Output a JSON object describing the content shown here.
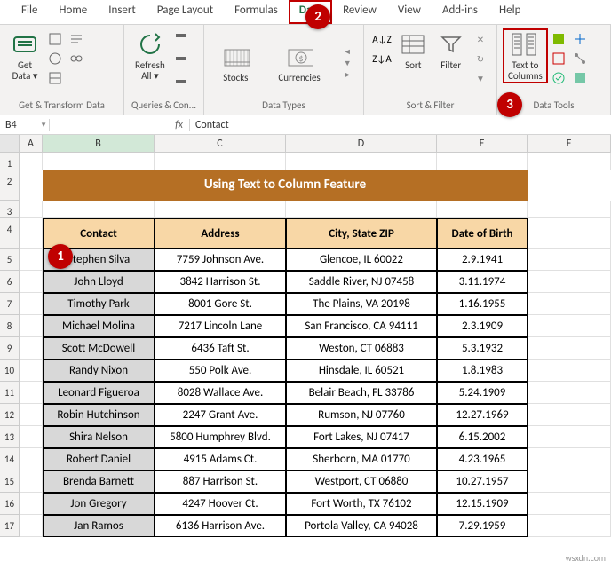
{
  "tabs": [
    "File",
    "Home",
    "Insert",
    "Page Layout",
    "Formulas",
    "Data",
    "Review",
    "View",
    "Add-ins",
    "Help"
  ],
  "active_tab": "Data",
  "ribbon": {
    "get_data": {
      "label": "Get\nData ▾",
      "group": "Get & Transform Data"
    },
    "refresh": {
      "label": "Refresh\nAll ▾",
      "group": "Queries & Con..."
    },
    "stocks": {
      "label": "Stocks"
    },
    "currencies": {
      "label": "Currencies"
    },
    "data_types_group": "Data Types",
    "sort": {
      "label": "Sort"
    },
    "filter": {
      "label": "Filter"
    },
    "sort_filter_group": "Sort & Filter",
    "text_to_columns": {
      "label": "Text to\nColumns"
    },
    "data_tools_group": "Data Tools"
  },
  "name_box": "B4",
  "formula": "Contact",
  "columns": [
    "A",
    "B",
    "C",
    "D",
    "E",
    "F"
  ],
  "title": "Using Text to Column Feature",
  "headers": {
    "contact": "Contact",
    "address": "Address",
    "city": "City, State ZIP",
    "dob": "Date of Birth"
  },
  "rows": [
    {
      "n": "5",
      "contact": "Stephen Silva",
      "address": "7759 Johnson Ave.",
      "city": "Glencoe, IL   60022",
      "dob": "2.9.1941"
    },
    {
      "n": "6",
      "contact": "John Lloyd",
      "address": "3842 Harrison St.",
      "city": "Saddle River, NJ 07458",
      "dob": "3.11.1974"
    },
    {
      "n": "7",
      "contact": "Timothy Park",
      "address": "8001 Gore St.",
      "city": "The Plains, VA   20198",
      "dob": "1.16.1955"
    },
    {
      "n": "8",
      "contact": "Michael Molina",
      "address": "7217 Lincoln Lane",
      "city": "San Francisco, CA   94111",
      "dob": "2.3.1909"
    },
    {
      "n": "9",
      "contact": "Scott McDowell",
      "address": "6436 Taft St.",
      "city": "Weston, CT   06883",
      "dob": "5.3.1932"
    },
    {
      "n": "10",
      "contact": "Randy Nixon",
      "address": "550 Polk Ave.",
      "city": "Hinsdale, IL   60521",
      "dob": "1.8.1983"
    },
    {
      "n": "11",
      "contact": "Leonard Figueroa",
      "address": "8028 Wallace Ave.",
      "city": "Belair Beach, FL   33786",
      "dob": "5.24.1909"
    },
    {
      "n": "12",
      "contact": "Robin Hutchinson",
      "address": "2247 Grant Ave.",
      "city": "Rumson, NJ   07760",
      "dob": "12.27.1969"
    },
    {
      "n": "13",
      "contact": "Shira Nelson",
      "address": "5800 Humphrey Blvd.",
      "city": "Fort Lakes, NJ   07417",
      "dob": "6.15.2002"
    },
    {
      "n": "14",
      "contact": "Robert Daniel",
      "address": "4915 Adams Ct.",
      "city": "Sherborn, MA   01770",
      "dob": "4.23.1965"
    },
    {
      "n": "15",
      "contact": "Brenda Barnett",
      "address": "887 Harrison St.",
      "city": "Westport, CT   06880",
      "dob": "10.27.1957"
    },
    {
      "n": "16",
      "contact": "Jon Gregory",
      "address": "4247 Hoover Ct.",
      "city": "Fort Worth, TX   76102",
      "dob": "12.15.1909"
    },
    {
      "n": "17",
      "contact": "Jan Ramos",
      "address": "6136 Harrison Ave.",
      "city": "Portola Valley, CA   94028",
      "dob": "7.29.1959"
    }
  ],
  "callouts": {
    "c1": "1",
    "c2": "2",
    "c3": "3"
  },
  "watermark": "wsxdn.com"
}
